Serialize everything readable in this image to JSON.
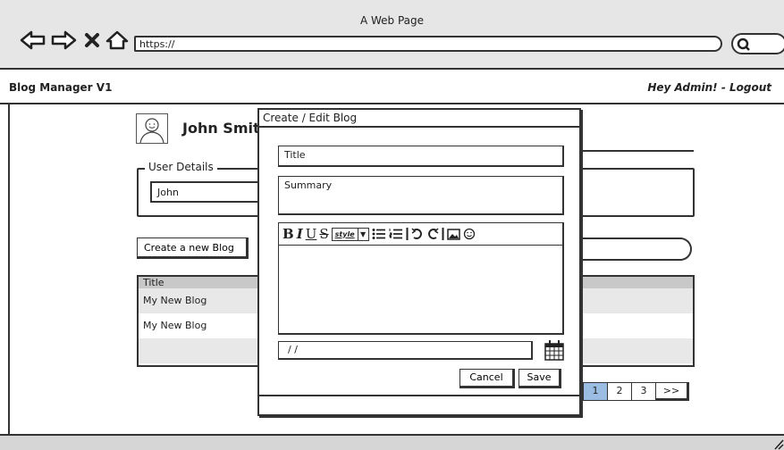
{
  "browser": {
    "window_title": "A Web Page",
    "url": "https://",
    "nav_icons": [
      "back-arrow-icon",
      "forward-arrow-icon",
      "stop-icon",
      "home-icon"
    ]
  },
  "app": {
    "name": "Blog Manager V1",
    "greeting": "Hey Admin! - Logout"
  },
  "profile": {
    "name": "John Smith",
    "details_legend": "User Details",
    "first_name_value": "John"
  },
  "actions": {
    "create_blog_label": "Create a new Blog"
  },
  "blog_table": {
    "header": "Title",
    "rows": [
      "My New Blog",
      "My New Blog",
      ""
    ]
  },
  "pagination": {
    "pages": [
      "1",
      "2",
      "3"
    ],
    "active_page": "1",
    "next_label": ">>"
  },
  "modal": {
    "title": "Create / Edit Blog",
    "title_placeholder": "Title",
    "summary_placeholder": "Summary",
    "toolbar": {
      "bold": "B",
      "italic": "I",
      "underline": "U",
      "strike": "S",
      "style_label": "style"
    },
    "date_value": "/ /",
    "cancel_label": "Cancel",
    "save_label": "Save"
  }
}
